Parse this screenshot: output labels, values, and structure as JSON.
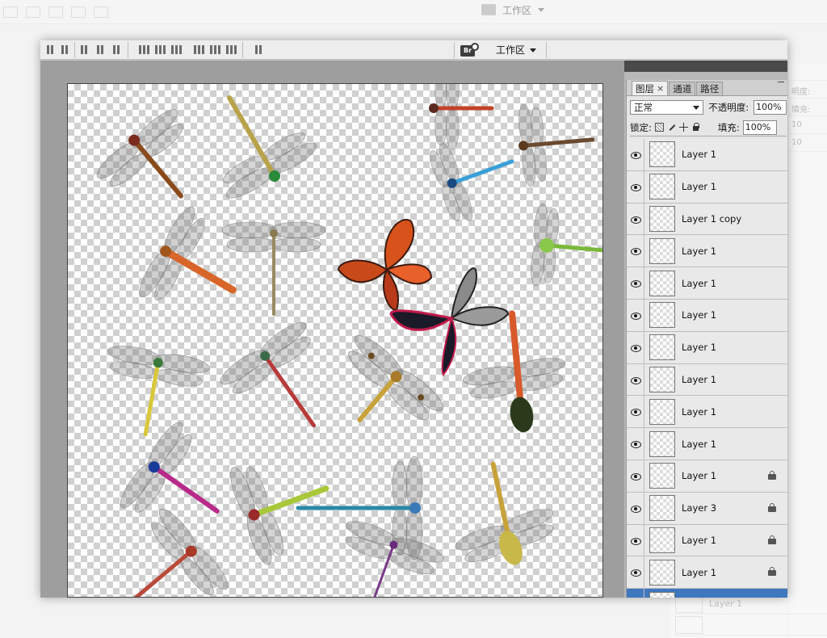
{
  "background_ui": {
    "workspace_label": "工作区",
    "side_labels": [
      "明度:",
      "填充:",
      "10",
      "10"
    ],
    "ghost_layer_name": "Layer 1"
  },
  "toolbar": {
    "bridge_icon": "br-icon",
    "workspace_label": "工作区"
  },
  "layers_panel": {
    "tabs": [
      {
        "label": "图层",
        "close": "×",
        "active": true
      },
      {
        "label": "通道",
        "active": false
      },
      {
        "label": "路径",
        "active": false
      }
    ],
    "blend_mode": "正常",
    "opacity_label": "不透明度:",
    "opacity_value": "100%",
    "lock_label": "锁定:",
    "fill_label": "填充:",
    "fill_value": "100%",
    "layers": [
      {
        "name": "Layer 1",
        "locked": false
      },
      {
        "name": "Layer 1",
        "locked": false
      },
      {
        "name": "Layer 1 copy",
        "locked": false
      },
      {
        "name": "Layer 1",
        "locked": false
      },
      {
        "name": "Layer 1",
        "locked": false
      },
      {
        "name": "Layer 1",
        "locked": false
      },
      {
        "name": "Layer 1",
        "locked": false
      },
      {
        "name": "Layer 1",
        "locked": false
      },
      {
        "name": "Layer 1",
        "locked": false
      },
      {
        "name": "Layer 1",
        "locked": false
      },
      {
        "name": "Layer 1",
        "locked": true
      },
      {
        "name": "Layer 3",
        "locked": true
      },
      {
        "name": "Layer 1",
        "locked": true
      },
      {
        "name": "Layer 1",
        "locked": true
      },
      {
        "name": "",
        "locked": false,
        "selected": true
      }
    ]
  },
  "colors": {
    "selection": "#3f78bd",
    "panel_bg": "#e6e6e6",
    "canvas_bg": "#9e9e9e"
  }
}
